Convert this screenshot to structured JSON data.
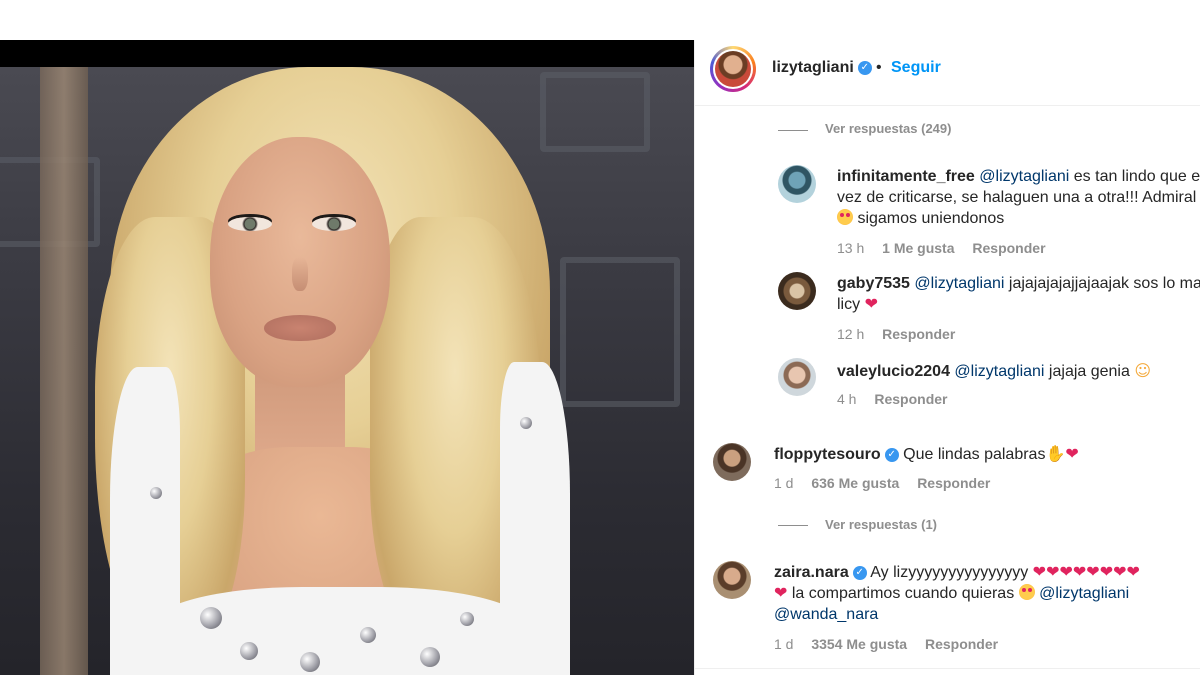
{
  "post": {
    "author": "lizytagliani",
    "separator": "•",
    "follow_label": "Seguir"
  },
  "comments": {
    "view_replies_1": "Ver respuestas (249)",
    "replies": [
      {
        "user": "infinitamente_free",
        "mention": "@lizytagliani",
        "text_line1": " es tan lindo que e",
        "line2": "vez de criticarse, se halaguen una a otra!!! Admiral",
        "line3": " sigamos uniendonos",
        "time": "13 h",
        "likes": "1 Me gusta",
        "reply_label": "Responder"
      },
      {
        "user": "gaby7535",
        "mention": "@lizytagliani",
        "text_line1": " jajajajajajjajaajak sos lo ma",
        "line2": "licy",
        "time": "12 h",
        "reply_label": "Responder"
      },
      {
        "user": "valeylucio2204",
        "mention": "@lizytagliani",
        "text_line1": " jajaja genia ",
        "time": "4 h",
        "reply_label": "Responder"
      }
    ],
    "floppy": {
      "user": "floppytesouro",
      "text": "Que lindas palabras",
      "time": "1 d",
      "likes": "636 Me gusta",
      "reply_label": "Responder"
    },
    "view_replies_2": "Ver respuestas (1)",
    "zaira": {
      "user": "zaira.nara",
      "text_line1": "Ay lizyyyyyyyyyyyyyyy",
      "line2": " la compartimos cuando quieras ",
      "mention1": "@lizytagliani",
      "mention2": "@wanda_nara",
      "time": "1 d",
      "likes": "3354 Me gusta",
      "reply_label": "Responder"
    }
  },
  "icons": {
    "verified": "verified-badge-icon",
    "heart": "red-heart-emoji",
    "heart_eyes": "heart-eyes-emoji"
  },
  "colors": {
    "link_blue": "#0095f6",
    "mention": "#00376b",
    "muted": "#8e8e8e",
    "verified": "#3897f0",
    "heart": "#e0245e"
  }
}
